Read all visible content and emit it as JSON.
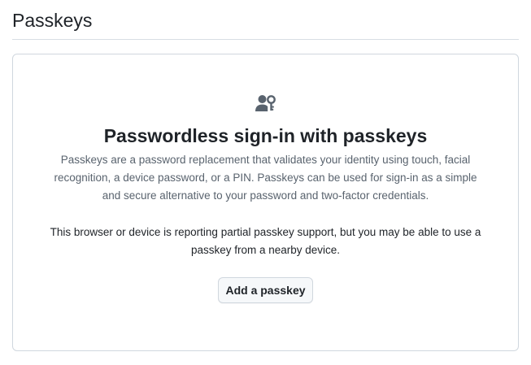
{
  "header": {
    "title": "Passkeys"
  },
  "blankslate": {
    "icon": "passkey-person-key-icon",
    "heading": "Passwordless sign-in with passkeys",
    "description": "Passkeys are a password replacement that validates your identity using touch, facial recognition, a device password, or a PIN. Passkeys can be used for sign-in as a simple and secure alternative to your password and two-factor credentials.",
    "note": "This browser or device is reporting partial passkey support, but you may be able to use a passkey from a nearby device.",
    "button_label": "Add a passkey"
  },
  "colors": {
    "text_primary": "#1f2328",
    "text_muted": "#59636e",
    "icon": "#59636e",
    "border": "#d0d7de",
    "button_bg": "#f6f8fa"
  }
}
